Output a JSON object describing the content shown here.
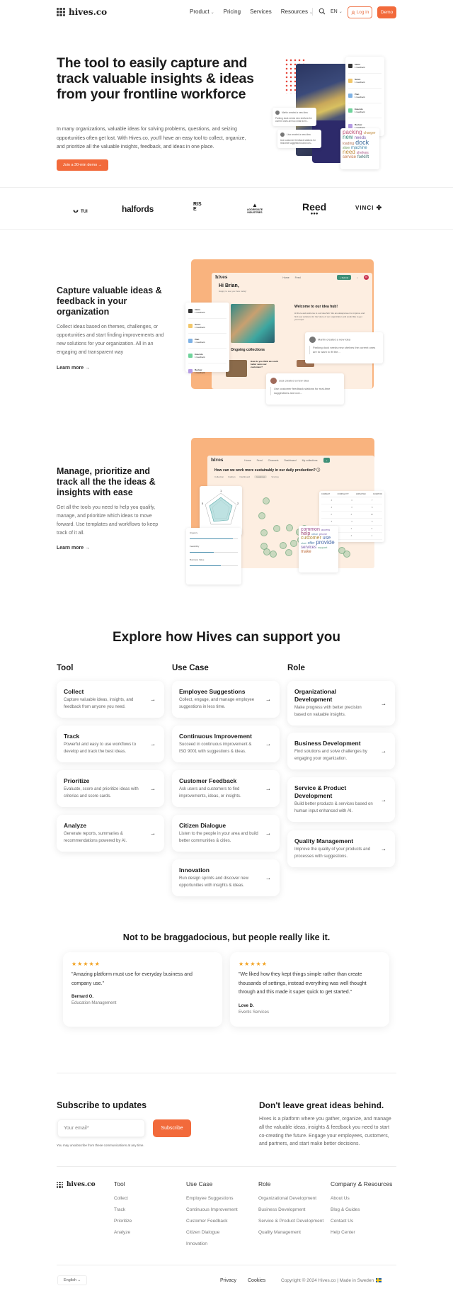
{
  "nav": {
    "brand": "hives.co",
    "links": [
      {
        "label": "Product",
        "has_dropdown": true
      },
      {
        "label": "Pricing",
        "has_dropdown": false
      },
      {
        "label": "Services",
        "has_dropdown": false
      },
      {
        "label": "Resources",
        "has_dropdown": true
      }
    ],
    "language": "EN",
    "login_label": "Log in",
    "demo_label": "Demo",
    "icons": {
      "search": "search-icon",
      "user": "user-icon",
      "chevron": "chevron-down-icon"
    }
  },
  "hero": {
    "title": "The tool to easily capture and track valuable insights & ideas from your frontline workforce",
    "description": "In many organizations, valuable ideas for solving problems, questions, and seizing opportunities often get lost. With Hives.co, you'll have an easy tool to collect, organize, and prioritize all the valuable insights, feedback, and ideas in one place.",
    "cta_label": "Join a 30-min demo →",
    "mock_list": [
      {
        "name": "Inbox",
        "sub": "1 feedback",
        "color": "#333333"
      },
      {
        "name": "Score",
        "sub": "1 feedback",
        "color": "#f2c76b"
      },
      {
        "name": "Plan",
        "sub": "1 feedback",
        "color": "#7fb2e5"
      },
      {
        "name": "Execute",
        "sub": "1 feedback",
        "color": "#6fd39b"
      },
      {
        "name": "Review",
        "sub": "1 feedback",
        "color": "#b59be3"
      }
    ],
    "mock_notifications": [
      {
        "text": "Martin created a new idea",
        "body": "Parking dock needs new shelves the current ones are too small to fit..."
      },
      {
        "text": "Lisa created a new idea",
        "body": "Use customer feedback stations for real-time suggestions and con..."
      }
    ],
    "word_cloud": [
      "packing",
      "charger",
      "new",
      "needs",
      "loading",
      "dock",
      "slow",
      "machine",
      "need",
      "shelves",
      "service",
      "forklift"
    ]
  },
  "logos": [
    "TUI",
    "halfords",
    "RISE",
    "AGGREGATE INDUSTRIES",
    "Reed",
    "VINCI"
  ],
  "feature1": {
    "title": "Capture valuable ideas & feedback in your organization",
    "description": "Collect ideas based on themes, challenges, or opportunities and start finding improvements and new solutions for your organization. All in an engaging and transparent way",
    "link_label": "Learn more →",
    "mock": {
      "brand": "hives",
      "nav": [
        "Home",
        "Feed"
      ],
      "submit_label": "+ Submit",
      "avatar_initial": "B",
      "greeting": "Hi Brian,",
      "greeting_sub": "Happy to see you here today!",
      "welcome_title": "Welcome to our idea hub!",
      "welcome_body": "Hi there and welcome to our idea hub. We are always keen to improve and find new solutions for the future of our organization and would like to get your input.",
      "collections_title": "Ongoing collections",
      "collection_1": "How do you think we could better serve our customers?",
      "collection_2": "Open Continuous Improvements",
      "list": [
        {
          "name": "Inbox",
          "sub": "1 feedback",
          "color": "#333333"
        },
        {
          "name": "Score",
          "sub": "1 feedback",
          "color": "#f2c76b"
        },
        {
          "name": "Plan",
          "sub": "1 feedback",
          "color": "#7fb2e5"
        },
        {
          "name": "Execute",
          "sub": "1 feedback",
          "color": "#6fd39b"
        },
        {
          "name": "Review",
          "sub": "1 feedback",
          "color": "#b59be3"
        }
      ],
      "notifications": [
        {
          "text": "Martin created a new idea",
          "body": "Parking dock needs new shelves the current ones are to warn to fit the..."
        },
        {
          "text": "Lisa created a new idea",
          "body": "Use customer feedback stations for real-time suggestions and con..."
        }
      ]
    }
  },
  "feature2": {
    "title": "Manage, prioritize and track all the the ideas & insights with ease",
    "description": "Get all the tools you need to help you qualify, manage, and prioritize which ideas to move forward. Use templates and workflows to keep track of it all.",
    "link_label": "Learn more →",
    "mock": {
      "brand": "hives",
      "nav": [
        "Home",
        "Feed",
        "Channels",
        "Dashboard",
        "My collections"
      ],
      "question": "How can we work more sustainably in our daily production? ⓘ",
      "tabs": [
        "Collection",
        "Kanban",
        "Dashboard",
        "Heatmap",
        "Scoring"
      ],
      "active_tab": "Heatmap",
      "radar_labels": [
        "1",
        "2",
        "5"
      ],
      "sliders": [
        {
          "label": "Urgency",
          "value_fraction": 0.9
        },
        {
          "label": "Feasibility",
          "value_fraction": 0.5
        },
        {
          "label": "Business Value",
          "value_fraction": 0.65
        }
      ],
      "table_headers": [
        "CURRENT",
        "COMPLEXITY",
        "EXPECTED",
        "DURATION"
      ],
      "table_rows": [
        [
          "3",
          "3",
          "7"
        ],
        [
          "4",
          "3",
          "8"
        ],
        [
          "3",
          "3",
          "13"
        ],
        [
          "3",
          "4",
          "5"
        ],
        [
          "",
          "4",
          "8"
        ],
        [
          "",
          "3",
          "2"
        ]
      ],
      "word_cloud": [
        "common",
        "access",
        "help",
        "clear",
        "phone",
        "customer",
        "use",
        "chat",
        "offer",
        "provide",
        "services",
        "support",
        "make"
      ]
    }
  },
  "explore": {
    "title": "Explore how Hives can support you",
    "columns": [
      {
        "heading": "Tool",
        "cards": [
          {
            "title": "Collect",
            "desc": "Capture valuable ideas, insights, and feedback from anyone you need."
          },
          {
            "title": "Track",
            "desc": "Powerful and easy to use workflows to develop and track the best ideas."
          },
          {
            "title": "Prioritize",
            "desc": "Evaluate, score and prioritize ideas with criterias and score cards."
          },
          {
            "title": "Analyze",
            "desc": "Generate reports, summaries & recommendations powered by AI."
          }
        ]
      },
      {
        "heading": "Use Case",
        "cards": [
          {
            "title": "Employee Suggestions",
            "desc": "Collect, engage, and manage employee suggestions in less time."
          },
          {
            "title": "Continuous Improvement",
            "desc": "Succeed in continuous improvement & ISO 9001 with suggestions & ideas."
          },
          {
            "title": "Customer Feedback",
            "desc": "Ask users and customers to find improvements, ideas, or insights."
          },
          {
            "title": "Citizen Dialogue",
            "desc": "Listen to the people in your area and build better communities & cities."
          },
          {
            "title": "Innovation",
            "desc": "Run design sprints and discover new opportunities with insights & ideas."
          }
        ]
      },
      {
        "heading": "Role",
        "cards": [
          {
            "title": "Organizational Development",
            "desc": "Make progress with better precision based on valuable insights."
          },
          {
            "title": "Business Development",
            "desc": "Find solutions and solve challenges by engaging your organization."
          },
          {
            "title": "Service & Product Development",
            "desc": "Build better products & services based on human input enhanced with AI."
          },
          {
            "title": "Quality Management",
            "desc": "Improve the quality of your products and processes with suggestions."
          }
        ]
      }
    ]
  },
  "testimonials": {
    "title": "Not to be braggadocious, but people really like it.",
    "items": [
      {
        "rating": 5,
        "stars": "★★★★★",
        "quote": "\"Amazing platform must use for everyday business and company use.\"",
        "name": "Bernard O.",
        "role": "Education Management"
      },
      {
        "rating": 5,
        "stars": "★★★★★",
        "quote": "\"We liked how they kept things simple rather than create thousands of settings, instead everything was well thought through and this made it super quick to get started.\"",
        "name": "Love D.",
        "role": "Events Services"
      }
    ]
  },
  "subscribe": {
    "title": "Subscribe to updates",
    "email_placeholder": "Your email*",
    "button_label": "Subscribe",
    "note": "You may unsubscribe from these communications at any time."
  },
  "cta": {
    "title": "Don't leave great ideas behind.",
    "description": "Hives is a platform where you gather, organize, and manage all the valuable ideas, insights & feedback you need to start co-creating the future. Engage your employees, customers, and partners, and start make better decisions."
  },
  "footer": {
    "brand": "hives.co",
    "columns": [
      {
        "heading": "Tool",
        "links": [
          "Collect",
          "Track",
          "Prioritize",
          "Analyze"
        ]
      },
      {
        "heading": "Use Case",
        "links": [
          "Employee Suggestions",
          "Continuous Improvement",
          "Customer Feedback",
          "Citizen Dialogue",
          "Innovation"
        ]
      },
      {
        "heading": "Role",
        "links": [
          "Organizational Development",
          "Business Development",
          "Service & Product Development",
          "Quality Management"
        ]
      },
      {
        "heading": "Company & Resources",
        "links": [
          "About Us",
          "Blog & Guides",
          "Contact Us",
          "Help Center"
        ]
      }
    ],
    "language": "English",
    "privacy": "Privacy",
    "cookies": "Cookies",
    "copyright": "Copyright © 2024 Hives.co | Made in Sweden"
  },
  "colors": {
    "accent": "#f26a3b",
    "peach": "#f9b37e",
    "app_bg": "#fdeee1",
    "teal": "#3e8f77",
    "star": "#f2a11f",
    "navy": "#2d2a6a"
  }
}
